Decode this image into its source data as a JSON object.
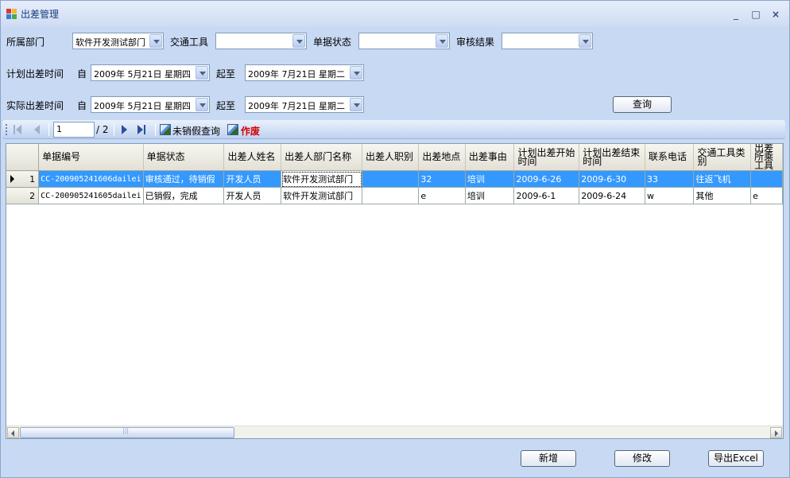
{
  "window": {
    "title": "出差管理",
    "controls": {
      "minimize": "_",
      "maximize": "□",
      "close": "×"
    }
  },
  "filters": {
    "department_label": "所属部门",
    "department_value": "软件开发测试部门",
    "transport_label": "交通工具",
    "transport_value": "",
    "status_label": "单据状态",
    "status_value": "",
    "review_label": "审核结果",
    "review_value": ""
  },
  "planned": {
    "label": "计划出差时间",
    "from_label": "自",
    "from_value": "2009年 5月21日 星期四",
    "to_label": "起至",
    "to_value": "2009年 7月21日 星期二"
  },
  "actual": {
    "label": "实际出差时间",
    "from_label": "自",
    "from_value": "2009年 5月21日 星期四",
    "to_label": "起至",
    "to_value": "2009年 7月21日 星期二"
  },
  "query_button": "查询",
  "navigator": {
    "current_page": "1",
    "total_pages": "/ 2",
    "unreturned_query": "未销假查询",
    "void": "作废"
  },
  "grid": {
    "columns": [
      "单据编号",
      "单据状态",
      "出差人姓名",
      "出差人部门名称",
      "出差人职别",
      "出差地点",
      "出差事由",
      "计划出差开始时间",
      "计划出差结束时间",
      "联系电话",
      "交通工具类别",
      "出差所乘工具"
    ],
    "rows": [
      {
        "num": "1",
        "cells": [
          "CC-200905241606dailei",
          "审核通过，待销假",
          "开发人员",
          "软件开发测试部门",
          "",
          "32",
          "培训",
          "2009-6-26",
          "2009-6-30",
          "33",
          "往返飞机",
          ""
        ]
      },
      {
        "num": "2",
        "cells": [
          "CC-200905241605dailei",
          "已销假，完成",
          "开发人员",
          "软件开发测试部门",
          "",
          "e",
          "培训",
          "2009-6-1",
          "2009-6-24",
          "w",
          "其他",
          "e"
        ]
      }
    ]
  },
  "buttons": {
    "add": "新增",
    "edit": "修改",
    "export": "导出Excel"
  },
  "colors": {
    "selection": "#3399ff",
    "void_text": "#d40000",
    "form_background": "#c8d9f3"
  }
}
